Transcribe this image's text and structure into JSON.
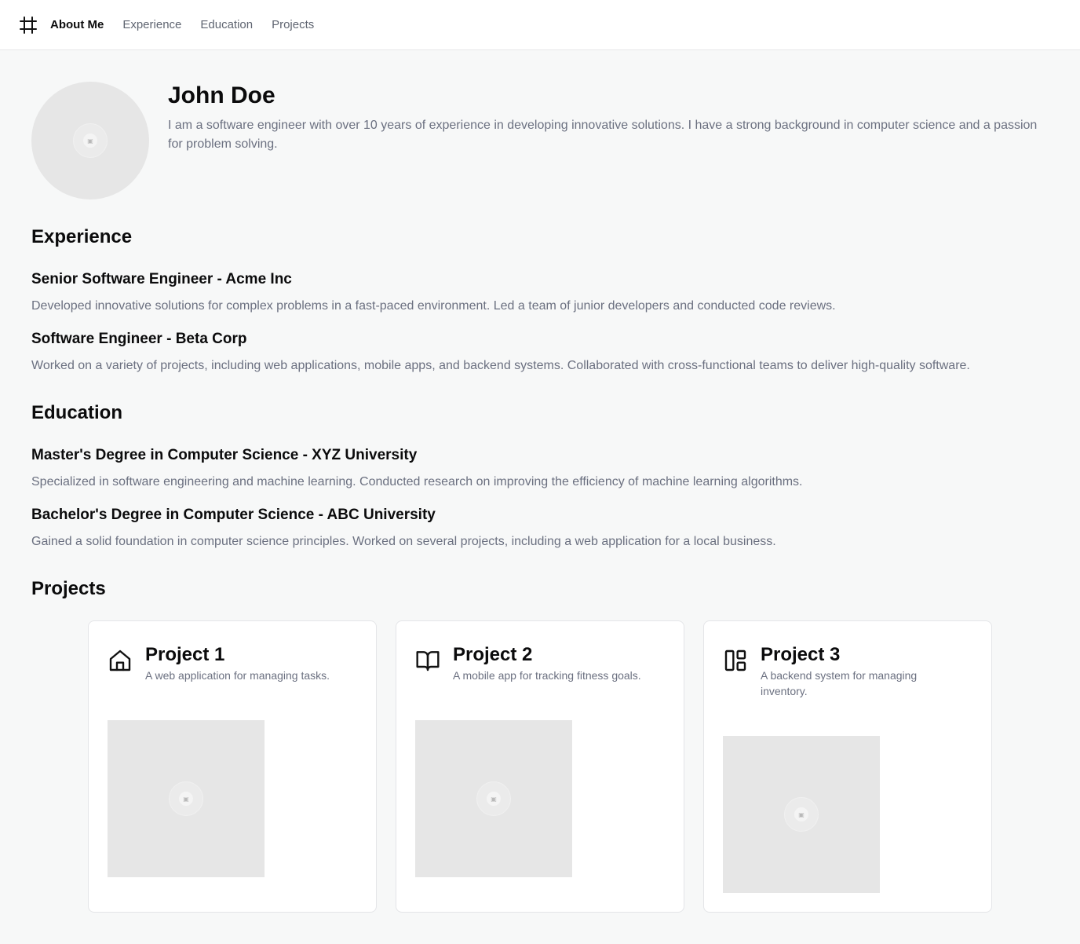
{
  "nav": {
    "logo_icon": "hash-grid-icon",
    "links": [
      "About Me",
      "Experience",
      "Education",
      "Projects"
    ],
    "active": "About Me"
  },
  "profile": {
    "name": "John Doe",
    "bio": "I am a software engineer with over 10 years of experience in developing innovative solutions. I have a strong background in computer science and a passion for problem solving."
  },
  "experience": {
    "title": "Experience",
    "items": [
      {
        "title": "Senior Software Engineer - Acme Inc",
        "description": "Developed innovative solutions for complex problems in a fast-paced environment. Led a team of junior developers and conducted code reviews."
      },
      {
        "title": "Software Engineer - Beta Corp",
        "description": "Worked on a variety of projects, including web applications, mobile apps, and backend systems. Collaborated with cross-functional teams to deliver high-quality software."
      }
    ]
  },
  "education": {
    "title": "Education",
    "items": [
      {
        "title": "Master's Degree in Computer Science - XYZ University",
        "description": "Specialized in software engineering and machine learning. Conducted research on improving the efficiency of machine learning algorithms."
      },
      {
        "title": "Bachelor's Degree in Computer Science - ABC University",
        "description": "Gained a solid foundation in computer science principles. Worked on several projects, including a web application for a local business."
      }
    ]
  },
  "projects": {
    "title": "Projects",
    "items": [
      {
        "title": "Project 1",
        "description": "A web application for managing tasks.",
        "icon": "home-icon"
      },
      {
        "title": "Project 2",
        "description": "A mobile app for tracking fitness goals.",
        "icon": "book-open-icon"
      },
      {
        "title": "Project 3",
        "description": "A backend system for managing inventory.",
        "icon": "layout-icon"
      }
    ]
  },
  "colors": {
    "background": "#f7f8f8",
    "text": "#0b0b0c",
    "muted": "#6b7080",
    "placeholder": "#e6e6e6"
  }
}
